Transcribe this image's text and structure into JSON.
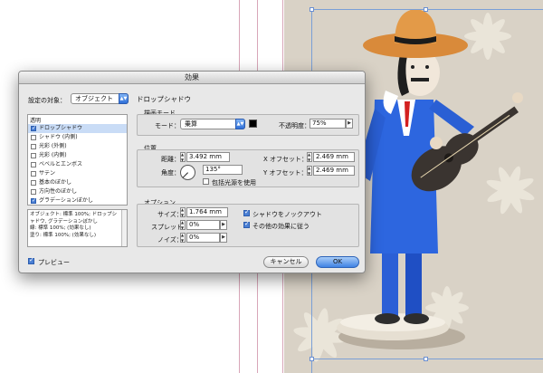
{
  "dialog": {
    "title": "効果",
    "target_label": "設定の対象：",
    "target_value": "オブジェクト",
    "effects_header": "透明",
    "effects": [
      {
        "label": "ドロップシャドウ",
        "checked": true,
        "selected": true
      },
      {
        "label": "シャドウ (内側)",
        "checked": false,
        "selected": false
      },
      {
        "label": "光彩 (外側)",
        "checked": false,
        "selected": false
      },
      {
        "label": "光彩 (内側)",
        "checked": false,
        "selected": false
      },
      {
        "label": "ベベルとエンボス",
        "checked": false,
        "selected": false
      },
      {
        "label": "サテン",
        "checked": false,
        "selected": false
      },
      {
        "label": "基本のぼかし",
        "checked": false,
        "selected": false
      },
      {
        "label": "方向性のぼかし",
        "checked": false,
        "selected": false
      },
      {
        "label": "グラデーションぼかし",
        "checked": true,
        "selected": false
      }
    ],
    "summary_text": "オブジェクト: 標準 100%; ドロップシャドウ, グラデーションぼかし\n線: 標準 100%; (効果なし)\n塗り: 標準 100%; (効果なし)",
    "preview_label": "プレビュー",
    "section_title": "ドロップシャドウ",
    "blend": {
      "group_label": "描画モード",
      "mode_label": "モード：",
      "mode_value": "乗算",
      "opacity_label": "不透明度：",
      "opacity_value": "75%"
    },
    "position": {
      "group_label": "位置",
      "distance_label": "距離：",
      "distance_value": "3.492 mm",
      "angle_label": "角度：",
      "angle_value": "135°",
      "global_light_label": "包括光源を使用",
      "x_offset_label": "X オフセット：",
      "x_offset_value": "2.469 mm",
      "y_offset_label": "Y オフセット：",
      "y_offset_value": "2.469 mm"
    },
    "options": {
      "group_label": "オプション",
      "size_label": "サイズ：",
      "size_value": "1.764 mm",
      "spread_label": "スプレッド：",
      "spread_value": "0%",
      "noise_label": "ノイズ：",
      "noise_value": "0%",
      "knockout_label": "シャドウをノックアウト",
      "honor_effects_label": "その他の効果に従う"
    },
    "cancel_label": "キャンセル",
    "ok_label": "OK"
  },
  "colors": {
    "accent": "#3f82e3",
    "shadow_color": "#000000"
  }
}
